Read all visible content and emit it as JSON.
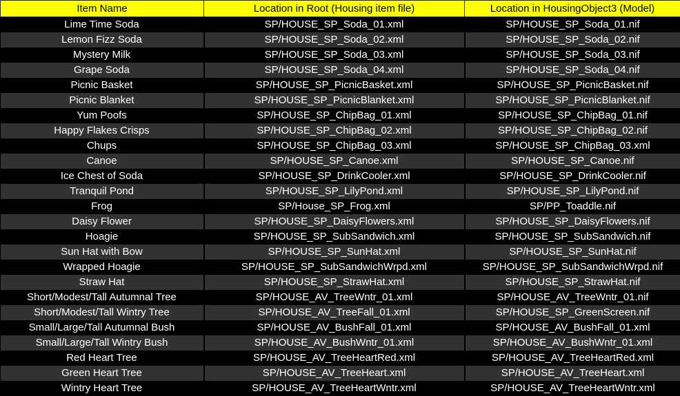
{
  "table": {
    "columns": [
      {
        "key": "item",
        "label": "Item Name"
      },
      {
        "key": "root",
        "label": "Location in Root (Housing item file)"
      },
      {
        "key": "model",
        "label": "Location in HousingObject3 (Model)"
      }
    ],
    "header_bg": "#FFFF00",
    "header_fg": "#000000",
    "row_bg_dark": "#000000",
    "row_bg_light": "#323232",
    "row_fg": "#FFFFFF",
    "rows": [
      {
        "item": "Lime Time Soda",
        "root": "SP/HOUSE_SP_Soda_01.xml",
        "model": "SP/HOUSE_SP_Soda_01.nif"
      },
      {
        "item": "Lemon Fizz Soda",
        "root": "SP/HOUSE_SP_Soda_02.xml",
        "model": "SP/HOUSE_SP_Soda_02.nif"
      },
      {
        "item": "Mystery Milk",
        "root": "SP/HOUSE_SP_Soda_03.xml",
        "model": "SP/HOUSE_SP_Soda_03.nif"
      },
      {
        "item": "Grape Soda",
        "root": "SP/HOUSE_SP_Soda_04.xml",
        "model": "SP/HOUSE_SP_Soda_04.nif"
      },
      {
        "item": "Picnic Basket",
        "root": "SP/HOUSE_SP_PicnicBasket.xml",
        "model": "SP/HOUSE_SP_PicnicBasket.nif"
      },
      {
        "item": "Picnic Blanket",
        "root": "SP/HOUSE_SP_PicnicBlanket.xml",
        "model": "SP/HOUSE_SP_PicnicBlanket.nif"
      },
      {
        "item": "Yum Poofs",
        "root": "SP/HOUSE_SP_ChipBag_01.xml",
        "model": "SP/HOUSE_SP_ChipBag_01.nif"
      },
      {
        "item": "Happy Flakes Crisps",
        "root": "SP/HOUSE_SP_ChipBag_02.xml",
        "model": "SP/HOUSE_SP_ChipBag_02.nif"
      },
      {
        "item": "Chups",
        "root": "SP/HOUSE_SP_ChipBag_03.xml",
        "model": "SP/HOUSE_SP_ChipBag_03.xml"
      },
      {
        "item": "Canoe",
        "root": "SP/HOUSE_SP_Canoe.xml",
        "model": "SP/HOUSE_SP_Canoe.nif"
      },
      {
        "item": "Ice Chest of Soda",
        "root": "SP/HOUSE_SP_DrinkCooler.xml",
        "model": "SP/HOUSE_SP_DrinkCooler.nif"
      },
      {
        "item": "Tranquil Pond",
        "root": "SP/HOUSE_SP_LilyPond.xml",
        "model": "SP/HOUSE_SP_LilyPond.nif"
      },
      {
        "item": "Frog",
        "root": "SP/House_SP_Frog.xml",
        "model": "SP/PP_Toaddle.nif"
      },
      {
        "item": "Daisy Flower",
        "root": "SP/HOUSE_SP_DaisyFlowers.xml",
        "model": "SP/HOUSE_SP_DaisyFlowers.nif"
      },
      {
        "item": "Hoagie",
        "root": "SP/HOUSE_SP_SubSandwich.xml",
        "model": "SP/HOUSE_SP_SubSandwich.nif"
      },
      {
        "item": "Sun Hat with Bow",
        "root": "SP/HOUSE_SP_SunHat.xml",
        "model": "SP/HOUSE_SP_SunHat.nif"
      },
      {
        "item": "Wrapped Hoagie",
        "root": "SP/HOUSE_SP_SubSandwichWrpd.xml",
        "model": "SP/HOUSE_SP_SubSandwichWrpd.nif"
      },
      {
        "item": "Straw Hat",
        "root": "SP/HOUSE_SP_StrawHat.xml",
        "model": "SP/HOUSE_SP_StrawHat.nif"
      },
      {
        "item": "Short/Modest/Tall Autumnal Tree",
        "root": "SP/HOUSE_AV_TreeWntr_01.xml",
        "model": "SP/HOUSE_AV_TreeWntr_01.nif"
      },
      {
        "item": "Short/Modest/Tall Wintry Tree",
        "root": "SP/HOUSE_AV_TreeFall_01.xml",
        "model": "SP/HOUSE_SP_GreenScreen.nif"
      },
      {
        "item": "Small/Large/Tall Autumnal Bush",
        "root": "SP/HOUSE_AV_BushFall_01.xml",
        "model": "SP/HOUSE_AV_BushFall_01.xml"
      },
      {
        "item": "Small/Large/Tall Wintry Bush",
        "root": "SP/HOUSE_AV_BushWntr_01.xml",
        "model": "SP/HOUSE_AV_BushWntr_01.xml"
      },
      {
        "item": "Red Heart Tree",
        "root": "SP/HOUSE_AV_TreeHeartRed.xml",
        "model": "SP/HOUSE_AV_TreeHeartRed.xml"
      },
      {
        "item": "Green Heart Tree",
        "root": "SP/HOUSE_AV_TreeHeart.xml",
        "model": "SP/HOUSE_AV_TreeHeart.xml"
      },
      {
        "item": "Wintry Heart Tree",
        "root": "SP/HOUSE_AV_TreeHeartWntr.xml",
        "model": "SP/HOUSE_AV_TreeHeartWntr.xml"
      }
    ]
  }
}
